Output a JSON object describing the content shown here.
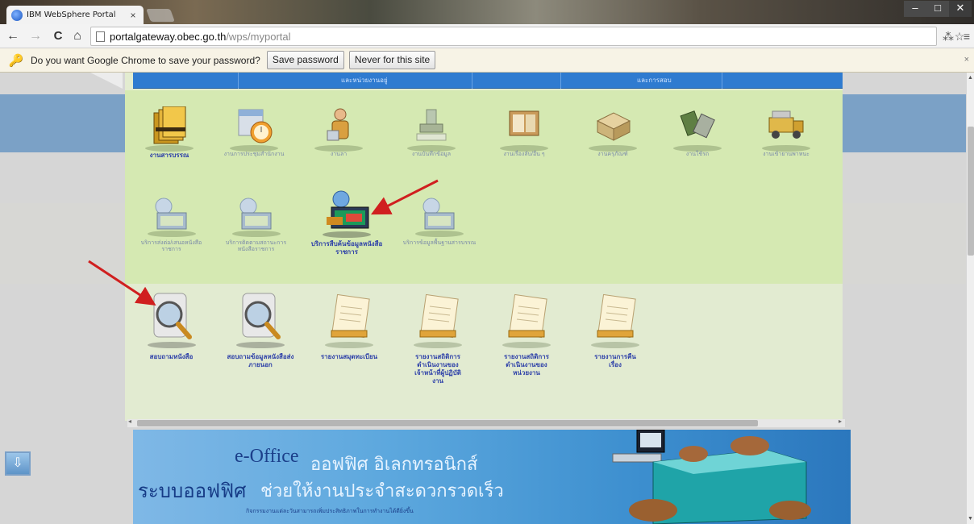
{
  "browser": {
    "tab_title": "IBM WebSphere Portal",
    "tab_close": "×",
    "window_controls": {
      "minimize": "–",
      "maximize": "□",
      "close": "✕"
    },
    "url_host": "portalgateway.obec.go.th",
    "url_path": "/wps/myportal",
    "nav": {
      "back": "←",
      "forward": "→",
      "reload": "C",
      "home": "⌂"
    },
    "toolbar_right": {
      "translate": "⁂",
      "star": "☆",
      "menu": "≡"
    }
  },
  "infobar": {
    "message": "Do you want Google Chrome to save your password?",
    "save_label": "Save password",
    "never_label": "Never for this site",
    "close": "×"
  },
  "portlet": {
    "header_left": "และหน่วยงานอยู่",
    "header_right": "และการสอบ",
    "row1": [
      {
        "label": "งานสารบรรณ",
        "icon": "folders-icon",
        "strong": true
      },
      {
        "label": "งานการประชุมสำนักงาน",
        "icon": "calendar-clock-icon"
      },
      {
        "label": "งานลา",
        "icon": "person-icon"
      },
      {
        "label": "งานบันทึกข้อมูล",
        "icon": "stamp-icon"
      },
      {
        "label": "งานเรื่องลับ/อื่น ๆ",
        "icon": "book-icon"
      },
      {
        "label": "งานครุภัณฑ์",
        "icon": "boxes-icon"
      },
      {
        "label": "งานใช้รถ",
        "icon": "tools-icon"
      },
      {
        "label": "งานเข้ายานพาหนะ",
        "icon": "truck-icon"
      }
    ],
    "row2": [
      {
        "label": "บริการส่งต่อ/เสนอหนังสือราชการ",
        "icon": "network-computer-icon"
      },
      {
        "label": "บริการติดตามสถานะการหนังสือราชการ",
        "icon": "network-computer-icon"
      },
      {
        "label": "บริการสืบค้นข้อมูลหนังสือราชการ",
        "icon": "search-computer-icon",
        "strong": true
      },
      {
        "label": "บริการข้อมูลพื้นฐานสารบรรณ",
        "icon": "network-computer-icon"
      }
    ],
    "row3": [
      {
        "label": "สอบถามหนังสือ",
        "icon": "magnifier-icon"
      },
      {
        "label": "สอบถามข้อมูลหนังสือส่งภายนอก",
        "icon": "magnifier-icon"
      },
      {
        "label": "รายงานสมุดทะเบียน",
        "icon": "notepad-icon"
      },
      {
        "label": "รายงานสถิติการดำเนินงานของเจ้าหน้าที่ผู้ปฏิบัติงาน",
        "icon": "notepad-icon"
      },
      {
        "label": "รายงานสถิติการดำเนินงานของหน่วยงาน",
        "icon": "notepad-icon"
      },
      {
        "label": "รายงานการคืนเรื่อง",
        "icon": "notepad-icon"
      }
    ]
  },
  "banner": {
    "eoffice": "e-Office",
    "thai_title": "ออฟฟิศ อิเลกทรอนิกส์",
    "thai_line2a": "ระบบออฟฟิศ",
    "thai_line2b": "ช่วยให้งานประจำสะดวกรวดเร็ว",
    "small_text": "กิจกรรมงานแต่ละวันสามารถเพิ่มประสิทธิภาพในการทำงานได้ดียิ่งขึ้น"
  },
  "side_button": "⇩",
  "colors": {
    "header_blue": "#2f7bd0",
    "green_panel": "#d5e9b2",
    "annotation_arrow": "#d01f1f",
    "label_blue": "#2c3fa8"
  }
}
